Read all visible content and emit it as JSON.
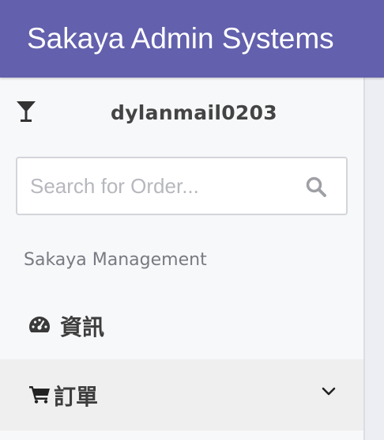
{
  "header": {
    "brand": "Sakaya Admin Systems",
    "background_color": "#6360ad"
  },
  "sidebar": {
    "user": {
      "icon": "martini-glass-icon",
      "username": "dylanmail0203"
    },
    "search": {
      "placeholder": "Search for Order...",
      "value": "",
      "icon": "search-icon"
    },
    "section_heading": "Sakaya Management",
    "items": [
      {
        "label": "資訊",
        "icon": "tachometer-icon",
        "expandable": false
      },
      {
        "label": "訂單",
        "icon": "shopping-cart-icon",
        "expandable": true,
        "expand_icon": "chevron-down-icon"
      }
    ]
  }
}
